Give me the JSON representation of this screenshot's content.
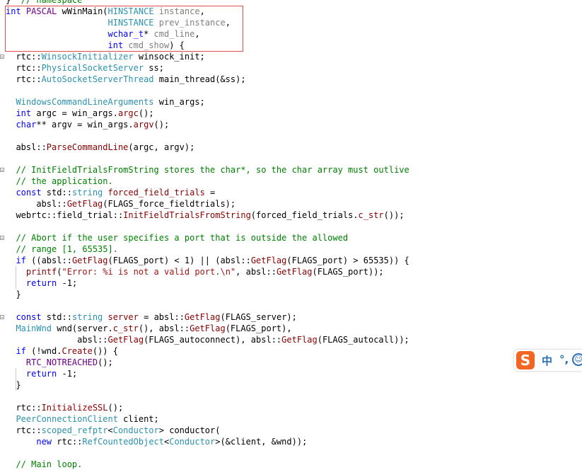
{
  "editor": {
    "lines": [
      {
        "tokens": [
          {
            "c": "t-plain",
            "t": "}  "
          },
          {
            "c": "t-cm",
            "t": "// namespace"
          }
        ]
      },
      {
        "tokens": [
          {
            "c": "t-kw",
            "t": "int"
          },
          {
            "c": "t-plain",
            "t": " "
          },
          {
            "c": "t-macro",
            "t": "PASCAL"
          },
          {
            "c": "t-plain",
            "t": " wWinMain("
          },
          {
            "c": "t-type",
            "t": "HINSTANCE"
          },
          {
            "c": "t-plain",
            "t": " "
          },
          {
            "c": "t-gray",
            "t": "instance"
          },
          {
            "c": "t-plain",
            "t": ","
          }
        ]
      },
      {
        "tokens": [
          {
            "c": "t-plain",
            "t": "                    "
          },
          {
            "c": "t-type",
            "t": "HINSTANCE"
          },
          {
            "c": "t-plain",
            "t": " "
          },
          {
            "c": "t-gray",
            "t": "prev_instance"
          },
          {
            "c": "t-plain",
            "t": ","
          }
        ]
      },
      {
        "tokens": [
          {
            "c": "t-plain",
            "t": "                    "
          },
          {
            "c": "t-kw",
            "t": "wchar_t"
          },
          {
            "c": "t-plain",
            "t": "* "
          },
          {
            "c": "t-gray",
            "t": "cmd_line"
          },
          {
            "c": "t-plain",
            "t": ","
          }
        ]
      },
      {
        "tokens": [
          {
            "c": "t-plain",
            "t": "                    "
          },
          {
            "c": "t-kw",
            "t": "int"
          },
          {
            "c": "t-plain",
            "t": " "
          },
          {
            "c": "t-gray",
            "t": "cmd_show"
          },
          {
            "c": "t-plain",
            "t": ") {"
          }
        ]
      },
      {
        "tokens": [
          {
            "c": "t-plain",
            "t": "  rtc::"
          },
          {
            "c": "t-type",
            "t": "WinsockInitializer"
          },
          {
            "c": "t-plain",
            "t": " winsock_init;"
          }
        ]
      },
      {
        "tokens": [
          {
            "c": "t-plain",
            "t": "  rtc::"
          },
          {
            "c": "t-type",
            "t": "PhysicalSocketServer"
          },
          {
            "c": "t-plain",
            "t": " ss;"
          }
        ]
      },
      {
        "tokens": [
          {
            "c": "t-plain",
            "t": "  rtc::"
          },
          {
            "c": "t-type",
            "t": "AutoSocketServerThread"
          },
          {
            "c": "t-plain",
            "t": " main_thread(&ss);"
          }
        ]
      },
      {
        "tokens": []
      },
      {
        "tokens": [
          {
            "c": "t-plain",
            "t": "  "
          },
          {
            "c": "t-type",
            "t": "WindowsCommandLineArguments"
          },
          {
            "c": "t-plain",
            "t": " win_args;"
          }
        ]
      },
      {
        "tokens": [
          {
            "c": "t-plain",
            "t": "  "
          },
          {
            "c": "t-kw",
            "t": "int"
          },
          {
            "c": "t-plain",
            "t": " argc = win_args."
          },
          {
            "c": "t-fn",
            "t": "argc"
          },
          {
            "c": "t-plain",
            "t": "();"
          }
        ]
      },
      {
        "tokens": [
          {
            "c": "t-plain",
            "t": "  "
          },
          {
            "c": "t-kw",
            "t": "char"
          },
          {
            "c": "t-plain",
            "t": "** argv = win_args."
          },
          {
            "c": "t-fn",
            "t": "argv"
          },
          {
            "c": "t-plain",
            "t": "();"
          }
        ]
      },
      {
        "tokens": []
      },
      {
        "tokens": [
          {
            "c": "t-plain",
            "t": "  absl::"
          },
          {
            "c": "t-fn",
            "t": "ParseCommandLine"
          },
          {
            "c": "t-plain",
            "t": "(argc, argv);"
          }
        ]
      },
      {
        "tokens": []
      },
      {
        "tokens": [
          {
            "c": "t-plain",
            "t": "  "
          },
          {
            "c": "t-cm",
            "t": "// InitFieldTrialsFromString stores the char*, so the char array must outlive"
          }
        ]
      },
      {
        "tokens": [
          {
            "c": "t-plain",
            "t": "  "
          },
          {
            "c": "t-cm",
            "t": "// the application."
          }
        ]
      },
      {
        "tokens": [
          {
            "c": "t-plain",
            "t": "  "
          },
          {
            "c": "t-kw",
            "t": "const"
          },
          {
            "c": "t-plain",
            "t": " std::"
          },
          {
            "c": "t-type",
            "t": "string"
          },
          {
            "c": "t-plain",
            "t": " "
          },
          {
            "c": "t-fn",
            "t": "forced_field_trials"
          },
          {
            "c": "t-plain",
            "t": " ="
          }
        ]
      },
      {
        "tokens": [
          {
            "c": "t-plain",
            "t": "      absl::"
          },
          {
            "c": "t-fn",
            "t": "GetFlag"
          },
          {
            "c": "t-plain",
            "t": "(FLAGS_force_fieldtrials);"
          }
        ]
      },
      {
        "tokens": [
          {
            "c": "t-plain",
            "t": "  webrtc::field_trial::"
          },
          {
            "c": "t-fn",
            "t": "InitFieldTrialsFromString"
          },
          {
            "c": "t-plain",
            "t": "(forced_field_trials."
          },
          {
            "c": "t-fn",
            "t": "c_str"
          },
          {
            "c": "t-plain",
            "t": "());"
          }
        ]
      },
      {
        "tokens": []
      },
      {
        "tokens": [
          {
            "c": "t-plain",
            "t": "  "
          },
          {
            "c": "t-cm",
            "t": "// Abort if the user specifies a port that is outside the allowed"
          }
        ]
      },
      {
        "tokens": [
          {
            "c": "t-plain",
            "t": "  "
          },
          {
            "c": "t-cm",
            "t": "// range [1, 65535]."
          }
        ]
      },
      {
        "tokens": [
          {
            "c": "t-plain",
            "t": "  "
          },
          {
            "c": "t-kw",
            "t": "if"
          },
          {
            "c": "t-plain",
            "t": " ((absl::"
          },
          {
            "c": "t-fn",
            "t": "GetFlag"
          },
          {
            "c": "t-plain",
            "t": "(FLAGS_port) < 1) || (absl::"
          },
          {
            "c": "t-fn",
            "t": "GetFlag"
          },
          {
            "c": "t-plain",
            "t": "(FLAGS_port) > 65535)) {"
          }
        ]
      },
      {
        "tokens": [
          {
            "c": "t-plain",
            "t": "    "
          },
          {
            "c": "t-fn",
            "t": "printf"
          },
          {
            "c": "t-plain",
            "t": "("
          },
          {
            "c": "t-str",
            "t": "\"Error: %i is not a valid port.\\n\""
          },
          {
            "c": "t-plain",
            "t": ", absl::"
          },
          {
            "c": "t-fn",
            "t": "GetFlag"
          },
          {
            "c": "t-plain",
            "t": "(FLAGS_port));"
          }
        ]
      },
      {
        "tokens": [
          {
            "c": "t-plain",
            "t": "    "
          },
          {
            "c": "t-kw",
            "t": "return"
          },
          {
            "c": "t-plain",
            "t": " -1;"
          }
        ]
      },
      {
        "tokens": [
          {
            "c": "t-plain",
            "t": "  }"
          }
        ]
      },
      {
        "tokens": []
      },
      {
        "tokens": [
          {
            "c": "t-plain",
            "t": "  "
          },
          {
            "c": "t-kw",
            "t": "const"
          },
          {
            "c": "t-plain",
            "t": " std::"
          },
          {
            "c": "t-type",
            "t": "string"
          },
          {
            "c": "t-plain",
            "t": " "
          },
          {
            "c": "t-fn",
            "t": "server"
          },
          {
            "c": "t-plain",
            "t": " = absl::"
          },
          {
            "c": "t-fn",
            "t": "GetFlag"
          },
          {
            "c": "t-plain",
            "t": "(FLAGS_server);"
          }
        ]
      },
      {
        "tokens": [
          {
            "c": "t-plain",
            "t": "  "
          },
          {
            "c": "t-type",
            "t": "MainWnd"
          },
          {
            "c": "t-plain",
            "t": " wnd(server."
          },
          {
            "c": "t-fn",
            "t": "c_str"
          },
          {
            "c": "t-plain",
            "t": "(), absl::"
          },
          {
            "c": "t-fn",
            "t": "GetFlag"
          },
          {
            "c": "t-plain",
            "t": "(FLAGS_port),"
          }
        ]
      },
      {
        "tokens": [
          {
            "c": "t-plain",
            "t": "              absl::"
          },
          {
            "c": "t-fn",
            "t": "GetFlag"
          },
          {
            "c": "t-plain",
            "t": "(FLAGS_autoconnect), absl::"
          },
          {
            "c": "t-fn",
            "t": "GetFlag"
          },
          {
            "c": "t-plain",
            "t": "(FLAGS_autocall));"
          }
        ]
      },
      {
        "tokens": [
          {
            "c": "t-plain",
            "t": "  "
          },
          {
            "c": "t-kw",
            "t": "if"
          },
          {
            "c": "t-plain",
            "t": " (!wnd."
          },
          {
            "c": "t-fn",
            "t": "Create"
          },
          {
            "c": "t-plain",
            "t": "()) {"
          }
        ]
      },
      {
        "tokens": [
          {
            "c": "t-plain",
            "t": "    "
          },
          {
            "c": "t-macro",
            "t": "RTC_NOTREACHED"
          },
          {
            "c": "t-plain",
            "t": "();"
          }
        ]
      },
      {
        "tokens": [
          {
            "c": "t-plain",
            "t": "    "
          },
          {
            "c": "t-kw",
            "t": "return"
          },
          {
            "c": "t-plain",
            "t": " -1;"
          }
        ]
      },
      {
        "tokens": [
          {
            "c": "t-plain",
            "t": "  }"
          }
        ]
      },
      {
        "tokens": []
      },
      {
        "tokens": [
          {
            "c": "t-plain",
            "t": "  rtc::"
          },
          {
            "c": "t-fn",
            "t": "InitializeSSL"
          },
          {
            "c": "t-plain",
            "t": "();"
          }
        ]
      },
      {
        "tokens": [
          {
            "c": "t-plain",
            "t": "  "
          },
          {
            "c": "t-type",
            "t": "PeerConnectionClient"
          },
          {
            "c": "t-plain",
            "t": " client;"
          }
        ]
      },
      {
        "tokens": [
          {
            "c": "t-plain",
            "t": "  rtc::"
          },
          {
            "c": "t-type",
            "t": "scoped_refptr"
          },
          {
            "c": "t-plain",
            "t": "<"
          },
          {
            "c": "t-type",
            "t": "Conductor"
          },
          {
            "c": "t-plain",
            "t": "> conductor("
          }
        ]
      },
      {
        "tokens": [
          {
            "c": "t-plain",
            "t": "      "
          },
          {
            "c": "t-kw",
            "t": "new"
          },
          {
            "c": "t-plain",
            "t": " rtc::"
          },
          {
            "c": "t-type",
            "t": "RefCountedObject"
          },
          {
            "c": "t-plain",
            "t": "<"
          },
          {
            "c": "t-type",
            "t": "Conductor"
          },
          {
            "c": "t-plain",
            "t": ">(&client, &wnd));"
          }
        ]
      },
      {
        "tokens": []
      },
      {
        "tokens": [
          {
            "c": "t-plain",
            "t": "  "
          },
          {
            "c": "t-cm",
            "t": "// Main loop."
          }
        ]
      }
    ]
  },
  "ime": {
    "logo": "S",
    "mode": "中",
    "punct": "°,",
    "emoji": "☺"
  },
  "colors": {
    "keyword": "#0000ff",
    "type": "#2b91af",
    "comment": "#008000",
    "function": "#880000",
    "string": "#a31515",
    "highlight_box": "#e14b4b"
  }
}
